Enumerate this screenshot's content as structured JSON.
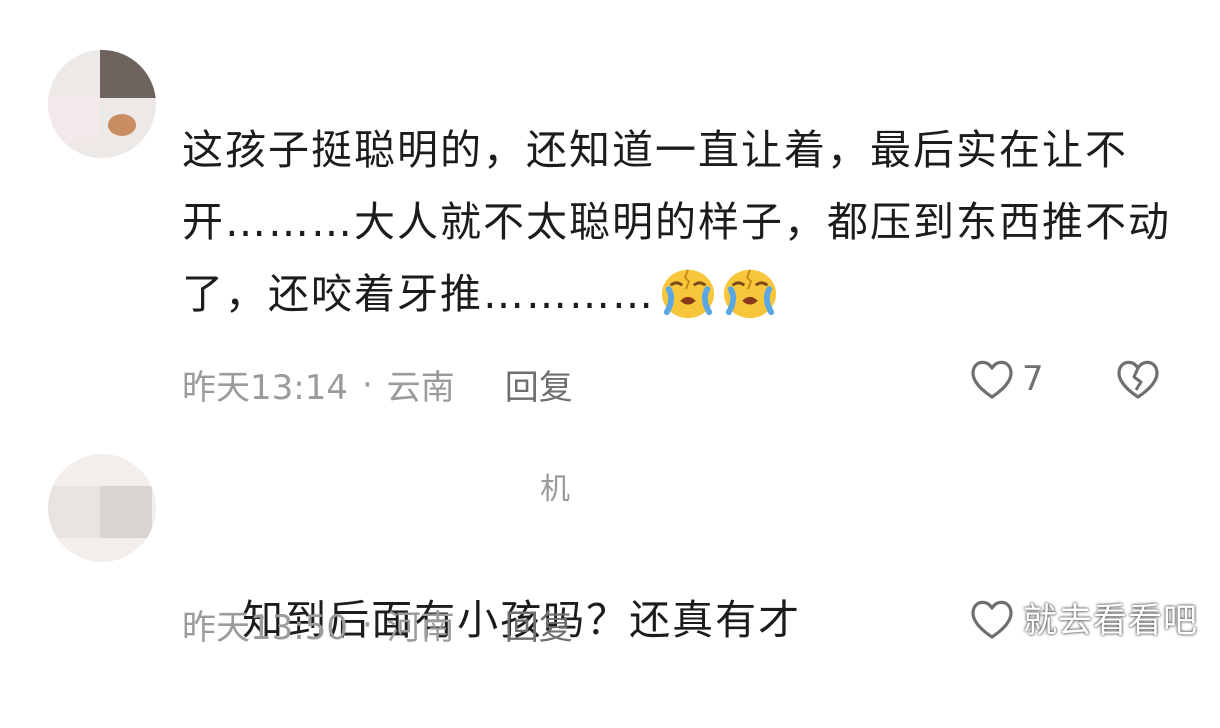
{
  "comments": [
    {
      "username": "",
      "text": "这孩子挺聪明的，还知道一直让着，最后实在让不开………大人就不太聪明的样子，都压到东西推不动了，还咬着牙推…………",
      "emojis": [
        "crying-face-icon",
        "crying-face-icon"
      ],
      "time": "昨天13:14",
      "location": "云南",
      "dot": "·",
      "reply_label": "回复",
      "likes": "7"
    },
    {
      "username": "机",
      "text": "知到后面有小孩吗？还真有才",
      "time": "昨天13:50",
      "location": "河南",
      "dot": "·",
      "reply_label": "回复",
      "likes": ""
    }
  ],
  "watermark": "就去看看吧",
  "colors": {
    "text": "#1c1c1c",
    "meta": "#9b9b9b",
    "icon": "#6f6f6f",
    "emoji_yellow": "#f7c63a",
    "emoji_tears": "#5aa7e6"
  }
}
